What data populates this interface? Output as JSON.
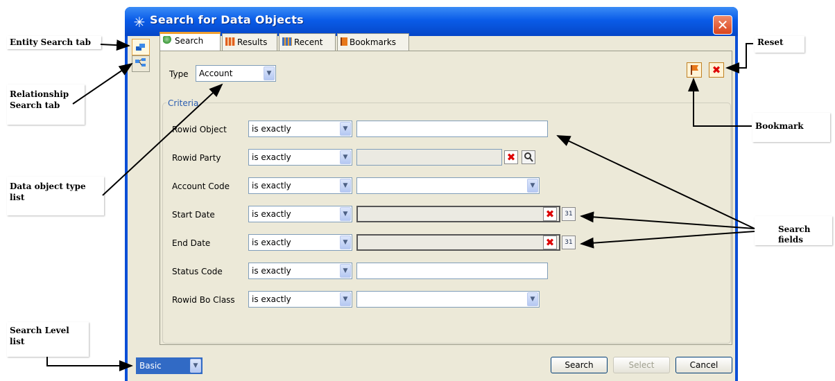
{
  "window": {
    "title": "Search for Data Objects"
  },
  "tabs": [
    {
      "label": "Search"
    },
    {
      "label": "Results"
    },
    {
      "label": "Recent"
    },
    {
      "label": "Bookmarks"
    }
  ],
  "type_label": "Type",
  "type_value": "Account",
  "criteria_legend": "Criteria",
  "criteria": [
    {
      "label": "Rowid Object",
      "operator": "is exactly"
    },
    {
      "label": "Rowid Party",
      "operator": "is exactly"
    },
    {
      "label": "Account Code",
      "operator": "is exactly"
    },
    {
      "label": "Start Date",
      "operator": "is exactly"
    },
    {
      "label": "End Date",
      "operator": "is exactly"
    },
    {
      "label": "Status Code",
      "operator": "is exactly"
    },
    {
      "label": "Rowid Bo Class",
      "operator": "is exactly"
    }
  ],
  "calendar_icon_text": "31",
  "search_level": "Basic",
  "buttons": {
    "search": "Search",
    "select": "Select",
    "cancel": "Cancel"
  },
  "annotations": {
    "entity_search_tab": "Entity Search tab",
    "relationship_search_tab": "Relationship Search tab",
    "data_object_type_list": "Data object type list",
    "search_level_list": "Search Level list",
    "reset": "Reset",
    "bookmark": "Bookmark",
    "search_fields": "Search fields"
  },
  "colors": {
    "titlebar": "#0a5ce8",
    "client": "#ece9d8",
    "tab_accent": "#f0a030",
    "search_level_bg": "#316ac5"
  }
}
